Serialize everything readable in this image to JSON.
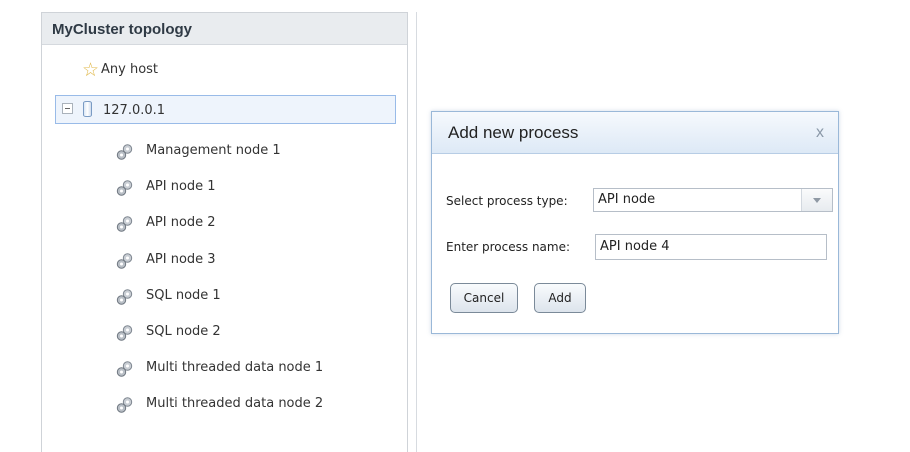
{
  "topology": {
    "title": "MyCluster topology",
    "any_host": "Any host",
    "host": "127.0.0.1",
    "processes": [
      {
        "label": "Management node 1"
      },
      {
        "label": "API node 1"
      },
      {
        "label": "API node 2"
      },
      {
        "label": "API node 3"
      },
      {
        "label": "SQL node 1"
      },
      {
        "label": "SQL node 2"
      },
      {
        "label": "Multi threaded data node 1"
      },
      {
        "label": "Multi threaded data node 2"
      }
    ]
  },
  "dialog": {
    "title": "Add new process",
    "close": "x",
    "type_label": "Select process type:",
    "type_value": "API node",
    "name_label": "Enter process name:",
    "name_value": "API node 4",
    "cancel_label": "Cancel",
    "add_label": "Add"
  },
  "icons": {
    "any_host": "star-icon",
    "host": "database-icon",
    "process": "gear-icon",
    "collapse": "collapse-icon"
  },
  "colors": {
    "selection_border": "#99bbe8",
    "dialog_title_bg": "#dde9f6",
    "star": "#e0b84a"
  }
}
